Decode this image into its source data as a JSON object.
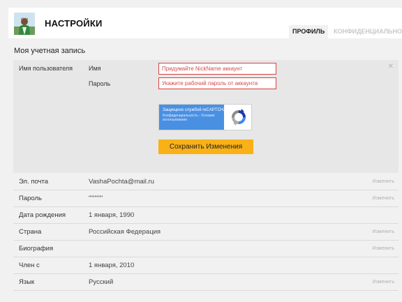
{
  "header": {
    "title": "НАСТРОЙКИ",
    "tabs": [
      {
        "label": "ПРОФИЛЬ"
      },
      {
        "label": "КОНФИДЕНЦИАЛЬНОСТЬ"
      }
    ]
  },
  "section_title": "Моя учетная запись",
  "form": {
    "row_label": "Имя пользователя",
    "name_label": "Имя",
    "password_label": "Пароль",
    "name_placeholder": "Придумайте NickName аккаунт",
    "password_placeholder": "Укажите рабочий пароль от аккаунта",
    "captcha_title": "Защищено службой reCAPTCHA",
    "captcha_links": "Конфиденциальность - Условия использования",
    "save_label": "Сохранить Изменения",
    "close_icon": "close-icon"
  },
  "rows": [
    {
      "label": "Эл. почта",
      "value": "VashaPochta@mail.ru",
      "edit": "Изменить"
    },
    {
      "label": "Пароль",
      "value": "\"\"\"\"\"\"",
      "edit": "Изменить"
    },
    {
      "label": "Дата рождения",
      "value": "1 января, 1990",
      "edit": ""
    },
    {
      "label": "Страна",
      "value": "Российская Федерация",
      "edit": "Изменить"
    },
    {
      "label": "Биография",
      "value": "",
      "edit": "Изменить"
    },
    {
      "label": "Член с",
      "value": "1 января, 2010",
      "edit": ""
    },
    {
      "label": "Язык",
      "value": "Русский",
      "edit": "Изменить"
    }
  ],
  "colors": {
    "accent_button": "#f9b117",
    "error_border": "#d94040",
    "captcha_blue": "#4a90e2"
  }
}
